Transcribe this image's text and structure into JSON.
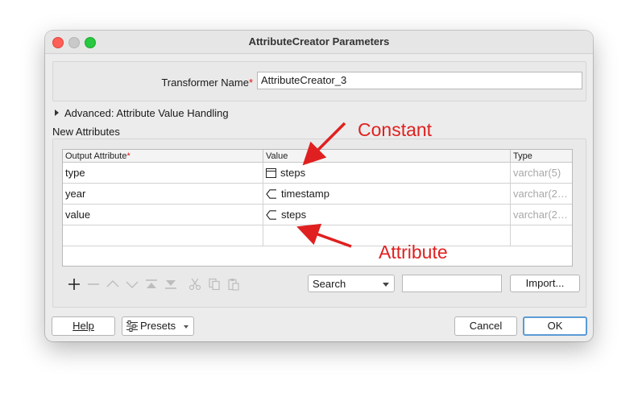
{
  "window": {
    "title": "AttributeCreator Parameters"
  },
  "transformer": {
    "label": "Transformer Name",
    "required_mark": "*",
    "value": "AttributeCreator_3"
  },
  "advanced": {
    "label": "Advanced: Attribute Value Handling"
  },
  "new_attributes": {
    "label": "New Attributes",
    "columns": {
      "output": "Output Attribute",
      "output_required": "*",
      "value": "Value",
      "type": "Type"
    },
    "rows": [
      {
        "output": "type",
        "value_icon": "constant-icon",
        "value": "steps",
        "type": "varchar(5)"
      },
      {
        "output": "year",
        "value_icon": "attribute-icon",
        "value": "timestamp",
        "type": "varchar(2…"
      },
      {
        "output": "value",
        "value_icon": "attribute-icon",
        "value": "steps",
        "type": "varchar(2…"
      }
    ]
  },
  "toolbar": {
    "icons": [
      "add-icon",
      "remove-icon",
      "move-up-icon",
      "move-down-icon",
      "move-top-icon",
      "move-bottom-icon",
      "cut-icon",
      "copy-icon",
      "paste-icon"
    ],
    "search_select": "Search",
    "search_value": "",
    "import_label": "Import..."
  },
  "footer": {
    "help_label": "Help",
    "presets_label": "Presets",
    "cancel_label": "Cancel",
    "ok_label": "OK"
  },
  "annotations": {
    "constant": "Constant",
    "attribute": "Attribute",
    "color": "#e02020"
  }
}
